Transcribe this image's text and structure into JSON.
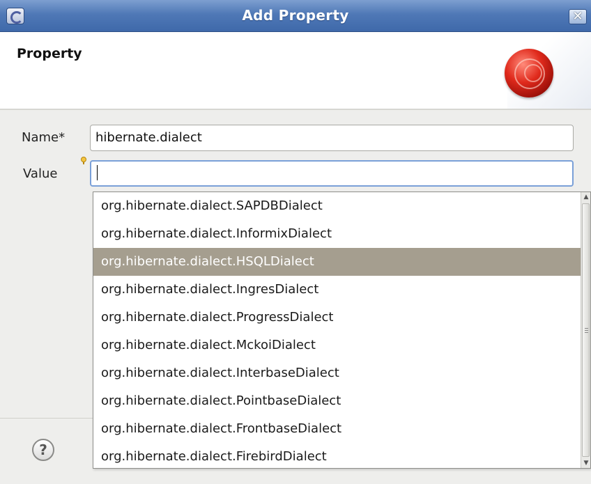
{
  "window": {
    "title": "Add Property",
    "close_glyph": "✕"
  },
  "header": {
    "title": "Property"
  },
  "form": {
    "name_label": "Name*",
    "name_value": "hibernate.dialect",
    "value_label": "Value",
    "value_value": ""
  },
  "popup": {
    "items": [
      "org.hibernate.dialect.SAPDBDialect",
      "org.hibernate.dialect.InformixDialect",
      "org.hibernate.dialect.HSQLDialect",
      "org.hibernate.dialect.IngresDialect",
      "org.hibernate.dialect.ProgressDialect",
      "org.hibernate.dialect.MckoiDialect",
      "org.hibernate.dialect.InterbaseDialect",
      "org.hibernate.dialect.PointbaseDialect",
      "org.hibernate.dialect.FrontbaseDialect",
      "org.hibernate.dialect.FirebirdDialect"
    ],
    "selected_index": 2
  },
  "footer": {
    "help_glyph": "?"
  },
  "icons": {
    "app": "eclipse-icon",
    "close": "close-icon",
    "banner": "hibernate-orb-icon",
    "assist": "content-assist-bulb-icon",
    "help": "help-icon"
  },
  "colors": {
    "titlebar": "#4f78b6",
    "selection": "#a59e8f",
    "focus_border": "#7aa0d8"
  }
}
